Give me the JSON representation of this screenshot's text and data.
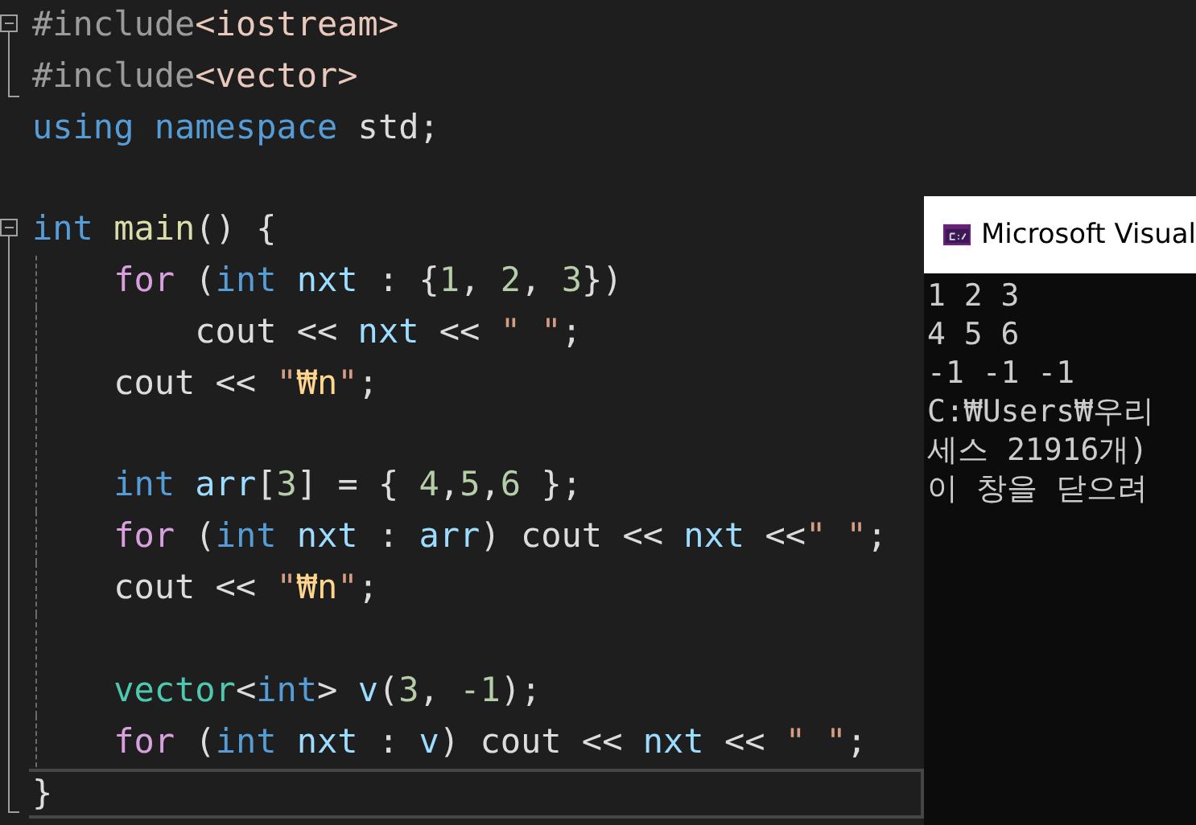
{
  "editor": {
    "lines": [
      {
        "gap_before": false,
        "collapsible": true,
        "block_end": false,
        "in_block": false,
        "current": false,
        "tokens": [
          {
            "kind": "preproc",
            "text": "#include"
          },
          {
            "kind": "header",
            "text": "<iostream>"
          }
        ]
      },
      {
        "gap_before": false,
        "collapsible": false,
        "block_end": true,
        "in_block": false,
        "current": false,
        "tokens": [
          {
            "kind": "preproc",
            "text": "#include"
          },
          {
            "kind": "header",
            "text": "<vector>"
          }
        ]
      },
      {
        "gap_before": false,
        "collapsible": false,
        "block_end": false,
        "in_block": false,
        "current": false,
        "tokens": [
          {
            "kind": "keyword",
            "text": "using namespace"
          },
          {
            "kind": "plain",
            "text": " std;"
          }
        ]
      },
      {
        "gap_before": true,
        "collapsible": true,
        "block_end": false,
        "in_block": false,
        "current": false,
        "tokens": [
          {
            "kind": "keyword",
            "text": "int"
          },
          {
            "kind": "func",
            "text": " main"
          },
          {
            "kind": "plain",
            "text": "() {"
          }
        ]
      },
      {
        "gap_before": false,
        "collapsible": false,
        "block_end": false,
        "in_block": true,
        "current": false,
        "tokens": [
          {
            "kind": "control",
            "text": "    for"
          },
          {
            "kind": "plain",
            "text": " ("
          },
          {
            "kind": "keyword",
            "text": "int"
          },
          {
            "kind": "var",
            "text": " nxt"
          },
          {
            "kind": "plain",
            "text": " : {"
          },
          {
            "kind": "number",
            "text": "1"
          },
          {
            "kind": "plain",
            "text": ", "
          },
          {
            "kind": "number",
            "text": "2"
          },
          {
            "kind": "plain",
            "text": ", "
          },
          {
            "kind": "number",
            "text": "3"
          },
          {
            "kind": "plain",
            "text": "})"
          }
        ]
      },
      {
        "gap_before": false,
        "collapsible": false,
        "block_end": false,
        "in_block": true,
        "current": false,
        "tokens": [
          {
            "kind": "plain",
            "text": "        cout << "
          },
          {
            "kind": "var",
            "text": "nxt"
          },
          {
            "kind": "plain",
            "text": " << "
          },
          {
            "kind": "string",
            "text": "\" \""
          },
          {
            "kind": "plain",
            "text": ";"
          }
        ]
      },
      {
        "gap_before": false,
        "collapsible": false,
        "block_end": false,
        "in_block": true,
        "current": false,
        "tokens": [
          {
            "kind": "plain",
            "text": "    cout << "
          },
          {
            "kind": "string",
            "text": "\""
          },
          {
            "kind": "escape",
            "text": "₩n"
          },
          {
            "kind": "string",
            "text": "\""
          },
          {
            "kind": "plain",
            "text": ";"
          }
        ]
      },
      {
        "gap_before": true,
        "collapsible": false,
        "block_end": false,
        "in_block": true,
        "current": false,
        "tokens": [
          {
            "kind": "keyword",
            "text": "    int"
          },
          {
            "kind": "var",
            "text": " arr"
          },
          {
            "kind": "plain",
            "text": "["
          },
          {
            "kind": "number",
            "text": "3"
          },
          {
            "kind": "plain",
            "text": "] = { "
          },
          {
            "kind": "number",
            "text": "4"
          },
          {
            "kind": "plain",
            "text": ","
          },
          {
            "kind": "number",
            "text": "5"
          },
          {
            "kind": "plain",
            "text": ","
          },
          {
            "kind": "number",
            "text": "6"
          },
          {
            "kind": "plain",
            "text": " };"
          }
        ]
      },
      {
        "gap_before": false,
        "collapsible": false,
        "block_end": false,
        "in_block": true,
        "current": false,
        "tokens": [
          {
            "kind": "control",
            "text": "    for"
          },
          {
            "kind": "plain",
            "text": " ("
          },
          {
            "kind": "keyword",
            "text": "int"
          },
          {
            "kind": "var",
            "text": " nxt"
          },
          {
            "kind": "plain",
            "text": " : "
          },
          {
            "kind": "var",
            "text": "arr"
          },
          {
            "kind": "plain",
            "text": ") cout << "
          },
          {
            "kind": "var",
            "text": "nxt"
          },
          {
            "kind": "plain",
            "text": " <<"
          },
          {
            "kind": "string",
            "text": "\" \""
          },
          {
            "kind": "plain",
            "text": ";"
          }
        ]
      },
      {
        "gap_before": false,
        "collapsible": false,
        "block_end": false,
        "in_block": true,
        "current": false,
        "tokens": [
          {
            "kind": "plain",
            "text": "    cout << "
          },
          {
            "kind": "string",
            "text": "\""
          },
          {
            "kind": "escape",
            "text": "₩n"
          },
          {
            "kind": "string",
            "text": "\""
          },
          {
            "kind": "plain",
            "text": ";"
          }
        ]
      },
      {
        "gap_before": true,
        "collapsible": false,
        "block_end": false,
        "in_block": true,
        "current": false,
        "tokens": [
          {
            "kind": "type",
            "text": "    vector"
          },
          {
            "kind": "plain",
            "text": "<"
          },
          {
            "kind": "keyword",
            "text": "int"
          },
          {
            "kind": "plain",
            "text": "> "
          },
          {
            "kind": "var",
            "text": "v"
          },
          {
            "kind": "plain",
            "text": "("
          },
          {
            "kind": "number",
            "text": "3"
          },
          {
            "kind": "plain",
            "text": ", "
          },
          {
            "kind": "number",
            "text": "-1"
          },
          {
            "kind": "plain",
            "text": ");"
          }
        ]
      },
      {
        "gap_before": false,
        "collapsible": false,
        "block_end": false,
        "in_block": true,
        "current": false,
        "tokens": [
          {
            "kind": "control",
            "text": "    for"
          },
          {
            "kind": "plain",
            "text": " ("
          },
          {
            "kind": "keyword",
            "text": "int"
          },
          {
            "kind": "var",
            "text": " nxt"
          },
          {
            "kind": "plain",
            "text": " : "
          },
          {
            "kind": "var",
            "text": "v"
          },
          {
            "kind": "plain",
            "text": ") cout << "
          },
          {
            "kind": "var",
            "text": "nxt"
          },
          {
            "kind": "plain",
            "text": " << "
          },
          {
            "kind": "string",
            "text": "\" \""
          },
          {
            "kind": "plain",
            "text": ";"
          }
        ]
      },
      {
        "gap_before": false,
        "collapsible": false,
        "block_end": true,
        "in_block": false,
        "current": true,
        "tokens": [
          {
            "kind": "plain",
            "text": "}"
          }
        ]
      }
    ]
  },
  "console": {
    "title": "Microsoft Visual",
    "lines": [
      "1 2 3",
      "4 5 6",
      "-1 -1 -1",
      "C:₩Users₩우리",
      "세스 21916개)",
      "이 창을 닫으려"
    ]
  }
}
